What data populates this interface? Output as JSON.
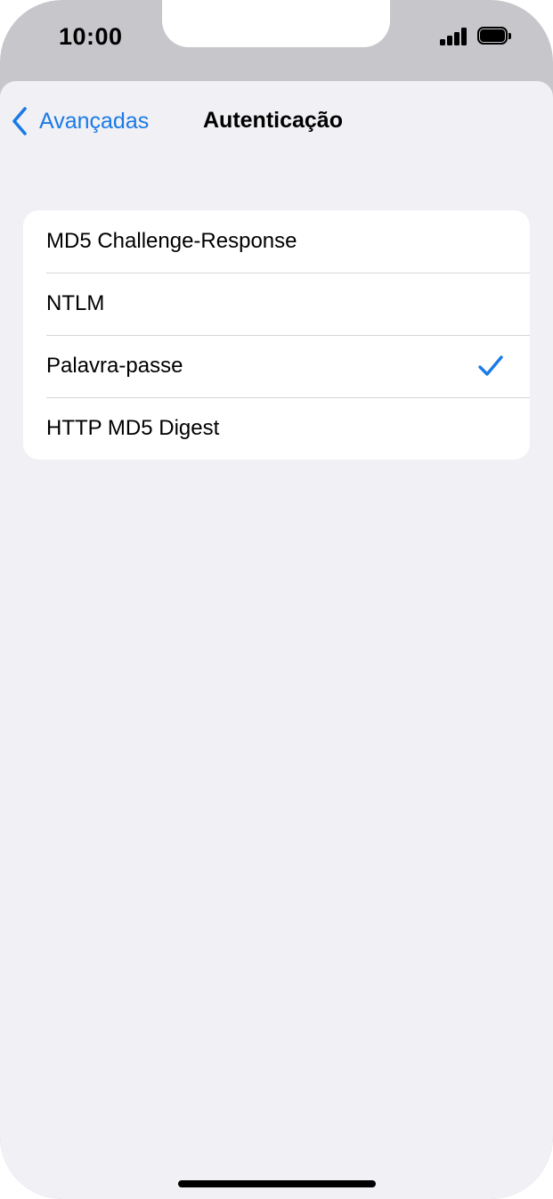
{
  "status_bar": {
    "time": "10:00",
    "signal_icon": "cellular-signal-icon",
    "battery_icon": "battery-full-icon"
  },
  "nav": {
    "back_label": "Avançadas",
    "back_icon": "chevron-left-icon",
    "title": "Autenticação"
  },
  "auth_options": {
    "items": [
      {
        "label": "MD5 Challenge-Response",
        "selected": false
      },
      {
        "label": "NTLM",
        "selected": false
      },
      {
        "label": "Palavra-passe",
        "selected": true
      },
      {
        "label": "HTTP MD5 Digest",
        "selected": false
      }
    ],
    "check_icon": "checkmark-icon"
  },
  "colors": {
    "accent": "#1a7ae6",
    "background": "#f0f0f5",
    "card": "#ffffff",
    "bezel": "#c6c6cb"
  }
}
